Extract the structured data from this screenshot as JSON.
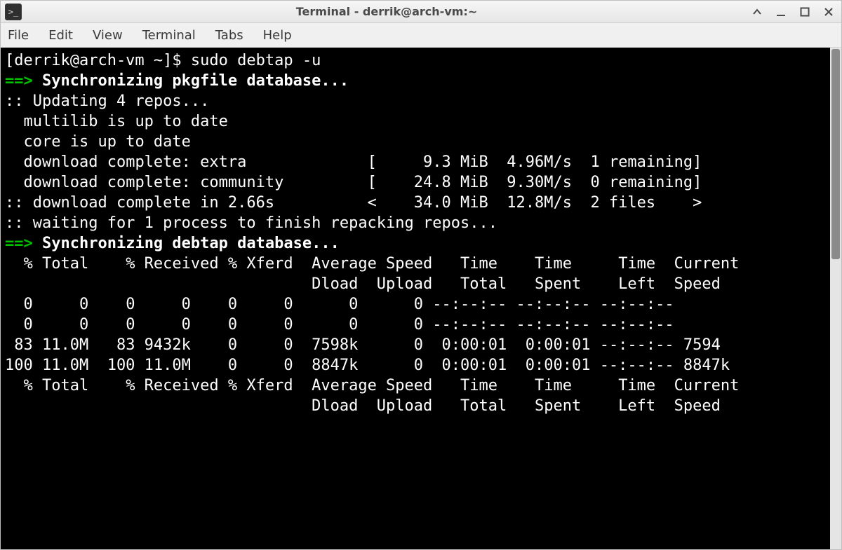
{
  "window": {
    "title": "Terminal - derrik@arch-vm:~"
  },
  "menubar": {
    "items": [
      "File",
      "Edit",
      "View",
      "Terminal",
      "Tabs",
      "Help"
    ]
  },
  "prompt": {
    "user_host": "[derrik@arch-vm ~]$ ",
    "command": "sudo debtap -u"
  },
  "output": {
    "sync_pkgfile_arrow": "==>",
    "sync_pkgfile_text": " Synchronizing pkgfile database...",
    "updating_repos": ":: Updating 4 repos...",
    "multilib": "  multilib is up to date",
    "core": "  core is up to date",
    "dl_extra": "  download complete: extra             [     9.3 MiB  4.96M/s  1 remaining]",
    "dl_community": "  download complete: community         [    24.8 MiB  9.30M/s  0 remaining]",
    "dl_summary": ":: download complete in 2.66s          <    34.0 MiB  12.8M/s  2 files    >",
    "waiting": ":: waiting for 1 process to finish repacking repos...",
    "sync_debtap_arrow": "==>",
    "sync_debtap_text": " Synchronizing debtap database...",
    "curl_header1": "  % Total    % Received % Xferd  Average Speed   Time    Time     Time  Current",
    "curl_header2": "                                 Dload  Upload   Total   Spent    Left  Speed",
    "curl_row0a": "  0     0    0     0    0     0      0      0 --:--:-- --:--:-- --:--:--",
    "curl_row0b": "  0     0    0     0    0     0      0      0 --:--:-- --:--:-- --:--:--",
    "curl_row1": " 83 11.0M   83 9432k    0     0  7598k      0  0:00:01  0:00:01 --:--:-- 7594",
    "curl_row2": "100 11.0M  100 11.0M    0     0  8847k      0  0:00:01  0:00:01 --:--:-- 8847k",
    "curl_header1b": "  % Total    % Received % Xferd  Average Speed   Time    Time     Time  Current",
    "curl_header2b": "                                 Dload  Upload   Total   Spent    Left  Speed"
  }
}
